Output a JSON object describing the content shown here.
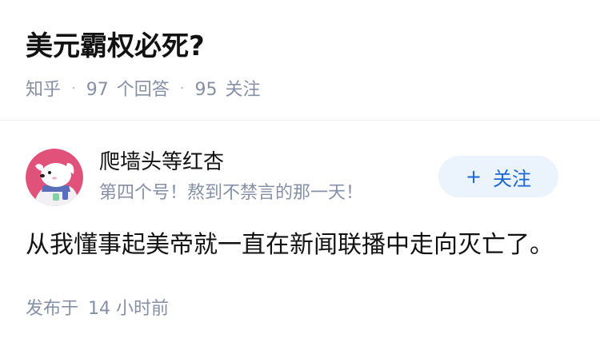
{
  "question": {
    "title": "美元霸权必死?",
    "source": "知乎",
    "answer_count": "97",
    "answer_label": "个回答",
    "follow_count": "95",
    "follow_label": "关注",
    "separator": "·"
  },
  "answer": {
    "author": {
      "name": "爬墙头等红杏",
      "bio": "第四个号！熬到不禁言的那一天！",
      "avatar_icon": "cartoon-dog-avatar-icon"
    },
    "follow_button": {
      "plus": "+",
      "label": "关注"
    },
    "content": "从我懂事起美帝就一直在新闻联播中走向灭亡了。",
    "publish_label": "发布于",
    "publish_time": "14 小时前"
  },
  "colors": {
    "accent": "#1a66d4",
    "button_bg": "#ebf3fd",
    "meta_text": "#8590a6",
    "avatar_bg": "#e0527a"
  }
}
